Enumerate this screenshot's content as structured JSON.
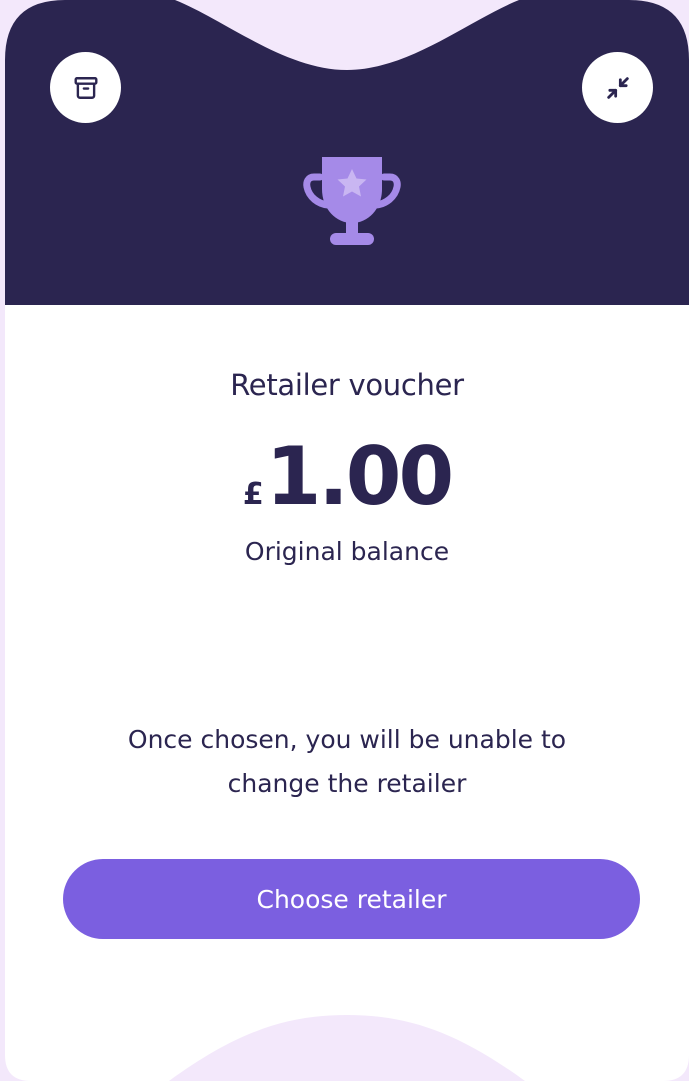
{
  "colors": {
    "page_background": "#f3e8fb",
    "header_background": "#2b2550",
    "card_background": "#ffffff",
    "accent": "#7b5fe0",
    "trophy": "#a58ae8",
    "text": "#2b2550"
  },
  "header": {
    "archive_icon": "archive-box-icon",
    "collapse_icon": "collapse-arrows-icon",
    "trophy_icon": "trophy-star-icon"
  },
  "voucher": {
    "title": "Retailer voucher",
    "currency": "£",
    "amount": "1.00",
    "balance_label": "Original balance"
  },
  "notice": {
    "line1": "Once chosen, you will be unable to",
    "line2": "change the retailer"
  },
  "actions": {
    "choose_label": "Choose retailer"
  }
}
